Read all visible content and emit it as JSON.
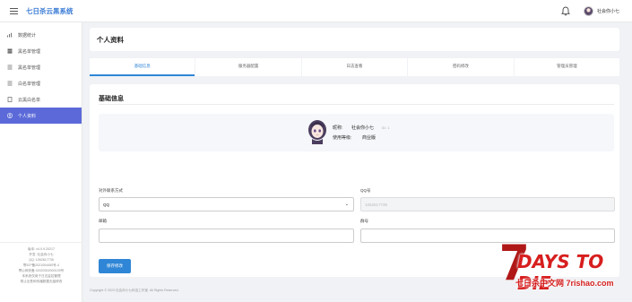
{
  "header": {
    "app_title": "七日杀云黑系统",
    "username": "社会你小七"
  },
  "sidebar": {
    "items": [
      {
        "label": "数据统计",
        "icon": "chart-icon"
      },
      {
        "label": "黑名单管理",
        "icon": "database-icon"
      },
      {
        "label": "黑名单管理",
        "icon": "list-icon"
      },
      {
        "label": "白名单管理",
        "icon": "list-icon"
      },
      {
        "label": "云黑白名单",
        "icon": "document-icon"
      },
      {
        "label": "个人资料",
        "icon": "user-icon",
        "active": true
      }
    ],
    "footer": [
      "版本: v4.0.9.20217",
      "开发: 社会你小七",
      "QQ: 1052617735",
      "鄂ICP备2021004450号-4",
      "鄂公网安备 42020302000139号",
      "本系统仅用于日志监控管理",
      "禁止出售和传播数据无敌修改"
    ]
  },
  "page": {
    "title": "个人资料"
  },
  "tabs": [
    {
      "label": "基础信息",
      "active": true
    },
    {
      "label": "服务器配置"
    },
    {
      "label": "日志查看"
    },
    {
      "label": "密码修改"
    },
    {
      "label": "管理员管理"
    }
  ],
  "profile": {
    "section_title": "基础信息",
    "nickname_label": "昵称:",
    "nickname": "社会你小七",
    "nickname_badge": "ID: 1",
    "level_label": "使用等级:",
    "level": "商业版"
  },
  "form": {
    "contact_label": "对外联系方式",
    "contact_value": "QQ",
    "qq_label": "QQ号",
    "qq_value": "1052617735",
    "email_label": "邮箱",
    "email_value": "",
    "group_label": "群号",
    "group_value": "",
    "save_label": "保存修改"
  },
  "footer": {
    "copyright": "Copyright © 2023 社会你小七科技工作室. All Rights Reserved."
  },
  "watermark": {
    "main": "DAYS TO DIE",
    "sub": "七日杀中文网 7rishao.com"
  },
  "colors": {
    "accent": "#2f86d6",
    "sidebar_active": "#5b6ad8",
    "brand_title": "#3a7bd5",
    "watermark_red": "#d71e1e"
  }
}
